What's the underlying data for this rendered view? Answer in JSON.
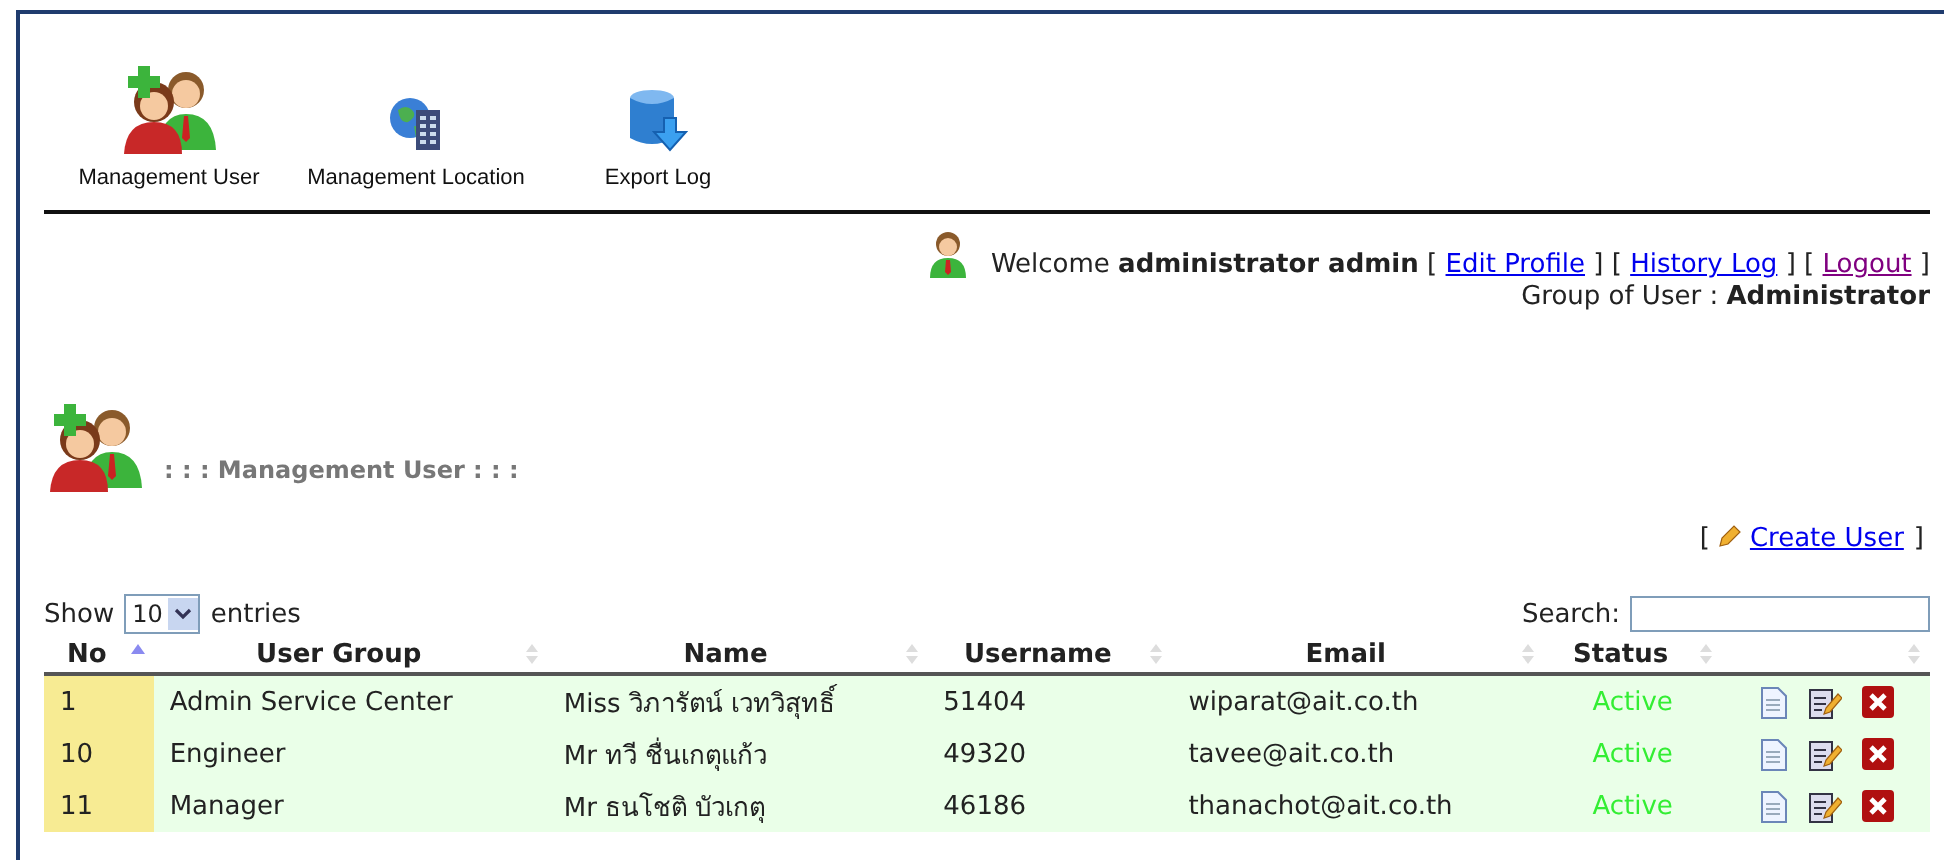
{
  "nav": [
    {
      "label": "Management User"
    },
    {
      "label": "Management Location"
    },
    {
      "label": "Export Log"
    }
  ],
  "welcome": {
    "greeting": "Welcome",
    "user": "administrator admin",
    "links": [
      {
        "open": "[",
        "label": "Edit Profile",
        "close": "]",
        "visited": false
      },
      {
        "open": "[",
        "label": "History Log",
        "close": "]",
        "visited": false
      },
      {
        "open": "[",
        "label": "Logout",
        "close": "]",
        "visited": true
      }
    ],
    "group_label": "Group of User :",
    "group": "Administrator"
  },
  "section_title": ": : : Management User : : :",
  "create_link": {
    "open": "[",
    "label": "Create User",
    "close": "]"
  },
  "length": {
    "prefix": "Show",
    "value": "10",
    "suffix": "entries"
  },
  "search": {
    "label": "Search:"
  },
  "table": {
    "columns": [
      {
        "label": "No",
        "sorted": true
      },
      {
        "label": "User Group",
        "sorted": false
      },
      {
        "label": "Name",
        "sorted": false
      },
      {
        "label": "Username",
        "sorted": false
      },
      {
        "label": "Email",
        "sorted": false
      },
      {
        "label": "Status",
        "sorted": false
      },
      {
        "sorted": false
      }
    ],
    "rows": [
      {
        "no": "1",
        "group": "Admin Service Center",
        "name": "Miss วิภารัตน์ เวทวิสุทธิ์",
        "username": "51404",
        "email": "wiparat@ait.co.th",
        "status": "Active",
        "active": true
      },
      {
        "no": "10",
        "group": "Engineer",
        "name": "Mr ทวี ชื่นเกตุแก้ว",
        "username": "49320",
        "email": "tavee@ait.co.th",
        "status": "Active",
        "active": true
      },
      {
        "no": "11",
        "group": "Manager",
        "name": "Mr ธนโชติ บัวเกตุ",
        "username": "46186",
        "email": "thanachot@ait.co.th",
        "status": "Active",
        "active": true
      }
    ]
  }
}
